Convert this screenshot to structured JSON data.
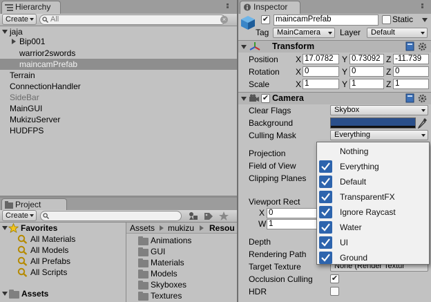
{
  "hierarchy": {
    "tab_label": "Hierarchy",
    "create_label": "Create",
    "search_placeholder": "All",
    "items": [
      {
        "label": "jaja",
        "expanded": true
      },
      {
        "label": "Bip001",
        "collapsed_arrow": true
      },
      {
        "label": "warrior2swords"
      },
      {
        "label": "maincamPrefab",
        "selected": true
      },
      {
        "label": "Terrain"
      },
      {
        "label": "ConnectionHandler"
      },
      {
        "label": "SideBar",
        "disabled": true
      },
      {
        "label": "MainGUI"
      },
      {
        "label": "MukizuServer"
      },
      {
        "label": "HUDFPS"
      }
    ]
  },
  "project": {
    "tab_label": "Project",
    "create_label": "Create",
    "favorites_label": "Favorites",
    "favorites": [
      "All Materials",
      "All Models",
      "All Prefabs",
      "All Scripts"
    ],
    "assets_label": "Assets",
    "breadcrumb": [
      "Assets",
      "mukizu",
      "Resou"
    ],
    "folders": [
      "Animations",
      "GUI",
      "Materials",
      "Models",
      "Skyboxes",
      "Textures"
    ]
  },
  "inspector": {
    "tab_label": "Inspector",
    "object_name": "maincamPrefab",
    "static_label": "Static",
    "tag_label": "Tag",
    "tag_value": "MainCamera",
    "layer_label": "Layer",
    "layer_value": "Default",
    "transform": {
      "title": "Transform",
      "rows": [
        {
          "label": "Position",
          "x": "17.0782",
          "y": "0.73092",
          "z": "-11.739"
        },
        {
          "label": "Rotation",
          "x": "0",
          "y": "0",
          "z": "0"
        },
        {
          "label": "Scale",
          "x": "1",
          "y": "1",
          "z": "1"
        }
      ],
      "axis_x": "X",
      "axis_y": "Y",
      "axis_z": "Z"
    },
    "camera": {
      "title": "Camera",
      "clear_flags_label": "Clear Flags",
      "clear_flags_value": "Skybox",
      "background_label": "Background",
      "background_color": "#2a4f8a",
      "culling_mask_label": "Culling Mask",
      "culling_mask_value": "Everything",
      "projection_label": "Projection",
      "fov_label": "Field of View",
      "clipping_label": "Clipping Planes",
      "viewport_label": "Viewport Rect",
      "viewport_x_label": "X",
      "viewport_x": "0",
      "viewport_w_label": "W",
      "viewport_w": "1",
      "depth_label": "Depth",
      "rendering_path_label": "Rendering Path",
      "target_texture_label": "Target Texture",
      "target_texture_value": "None (Render Textur",
      "occlusion_label": "Occlusion Culling",
      "occlusion_checked": true,
      "hdr_label": "HDR",
      "hdr_checked": false
    }
  },
  "culling_popup": {
    "items": [
      {
        "label": "Nothing",
        "checked": false
      },
      {
        "label": "Everything",
        "checked": true
      },
      {
        "label": "Default",
        "checked": true
      },
      {
        "label": "TransparentFX",
        "checked": true
      },
      {
        "label": "Ignore Raycast",
        "checked": true
      },
      {
        "label": "Water",
        "checked": true
      },
      {
        "label": "UI",
        "checked": true
      },
      {
        "label": "Ground",
        "checked": true
      }
    ],
    "accent": "#2d64ad"
  }
}
